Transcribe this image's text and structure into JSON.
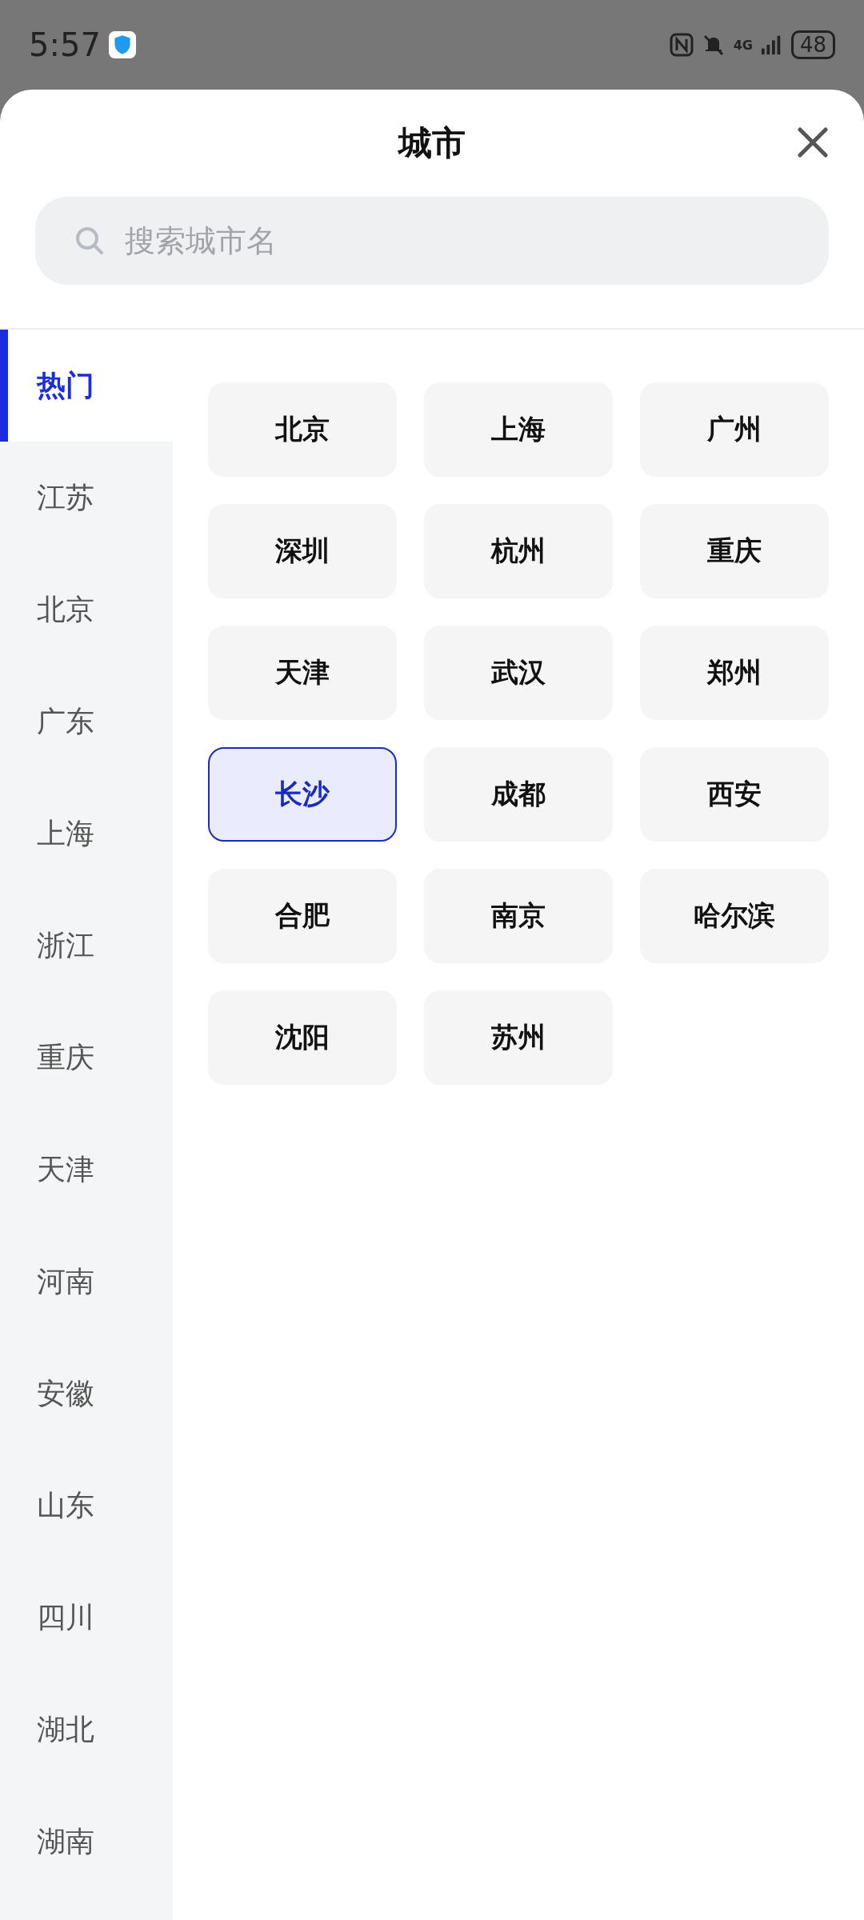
{
  "status_bar": {
    "time": "5:57",
    "network": "4G",
    "battery": "48"
  },
  "title": "城市",
  "search": {
    "placeholder": "搜索城市名"
  },
  "sidebar": {
    "items": [
      {
        "label": "热门",
        "selected": true
      },
      {
        "label": "江苏",
        "selected": false
      },
      {
        "label": "北京",
        "selected": false
      },
      {
        "label": "广东",
        "selected": false
      },
      {
        "label": "上海",
        "selected": false
      },
      {
        "label": "浙江",
        "selected": false
      },
      {
        "label": "重庆",
        "selected": false
      },
      {
        "label": "天津",
        "selected": false
      },
      {
        "label": "河南",
        "selected": false
      },
      {
        "label": "安徽",
        "selected": false
      },
      {
        "label": "山东",
        "selected": false
      },
      {
        "label": "四川",
        "selected": false
      },
      {
        "label": "湖北",
        "selected": false
      },
      {
        "label": "湖南",
        "selected": false
      }
    ]
  },
  "cities": [
    {
      "label": "北京",
      "selected": false
    },
    {
      "label": "上海",
      "selected": false
    },
    {
      "label": "广州",
      "selected": false
    },
    {
      "label": "深圳",
      "selected": false
    },
    {
      "label": "杭州",
      "selected": false
    },
    {
      "label": "重庆",
      "selected": false
    },
    {
      "label": "天津",
      "selected": false
    },
    {
      "label": "武汉",
      "selected": false
    },
    {
      "label": "郑州",
      "selected": false
    },
    {
      "label": "长沙",
      "selected": true
    },
    {
      "label": "成都",
      "selected": false
    },
    {
      "label": "西安",
      "selected": false
    },
    {
      "label": "合肥",
      "selected": false
    },
    {
      "label": "南京",
      "selected": false
    },
    {
      "label": "哈尔滨",
      "selected": false
    },
    {
      "label": "沈阳",
      "selected": false
    },
    {
      "label": "苏州",
      "selected": false
    }
  ]
}
